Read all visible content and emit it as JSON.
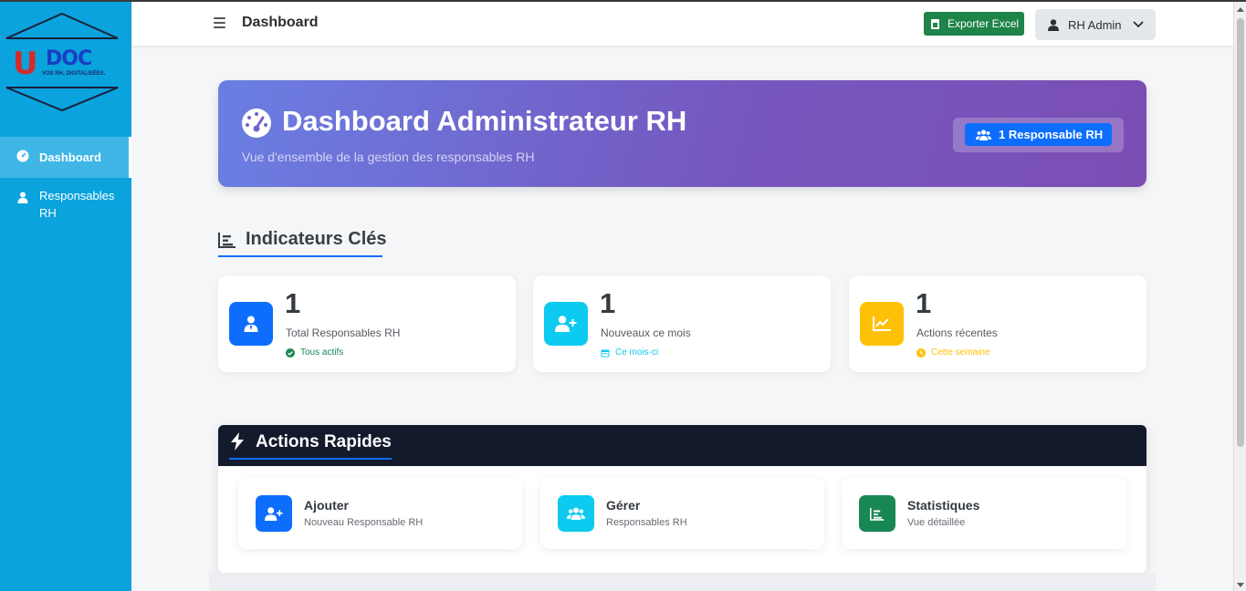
{
  "sidebar": {
    "logo": {
      "mark": "U",
      "name": "DOC",
      "tagline": "VOS RH, DIGITALISÉES."
    },
    "items": [
      {
        "label": "Dashboard",
        "icon": "gauge-icon",
        "active": true
      },
      {
        "label": "Responsables RH",
        "icon": "user-tie-icon",
        "active": false
      }
    ],
    "color": "#0aa3dd"
  },
  "topbar": {
    "title": "Dashboard",
    "export_label": "Exporter Excel",
    "user_label": "RH Admin"
  },
  "hero": {
    "title": "Dashboard Administrateur RH",
    "subtitle": "Vue d'ensemble de la gestion des responsables RH",
    "badge": "1 Responsable RH"
  },
  "kpi_section": {
    "title": "Indicateurs Clés",
    "cards": [
      {
        "value": "1",
        "label": "Total Responsables RH",
        "note": "Tous actifs",
        "color": "#0d6efd",
        "note_color": "#198754",
        "icon": "user-tie-icon"
      },
      {
        "value": "1",
        "label": "Nouveaux ce mois",
        "note": "Ce mois-ci",
        "color": "#0dcaf0",
        "note_color": "#0dcaf0",
        "icon": "user-plus-icon"
      },
      {
        "value": "1",
        "label": "Actions récentes",
        "note": "Cette semaine",
        "color": "#ffc107",
        "note_color": "#ffc107",
        "icon": "chart-line-icon"
      }
    ]
  },
  "actions": {
    "title": "Actions Rapides",
    "cards": [
      {
        "title": "Ajouter",
        "subtitle": "Nouveau Responsable RH",
        "color": "#0d6efd",
        "icon": "user-plus-icon"
      },
      {
        "title": "Gérer",
        "subtitle": "Responsables RH",
        "color": "#0dcaf0",
        "icon": "users-icon"
      },
      {
        "title": "Statistiques",
        "subtitle": "Vue détaillée",
        "color": "#198754",
        "icon": "chart-bar-icon"
      }
    ]
  }
}
